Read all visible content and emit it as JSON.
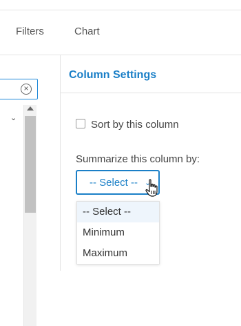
{
  "tabs": {
    "filters": "Filters",
    "chart": "Chart"
  },
  "search": {
    "clear_icon_glyph": "×"
  },
  "column_settings": {
    "title": "Column Settings",
    "sort_label": "Sort by this column",
    "sort_checked": false,
    "summarize_label": "Summarize this column by:",
    "select": {
      "value": "-- Select --",
      "options": [
        "-- Select --",
        "Minimum",
        "Maximum"
      ]
    }
  },
  "colors": {
    "accent": "#1a7fc7",
    "selected_option_bg": "#eef5fc"
  }
}
